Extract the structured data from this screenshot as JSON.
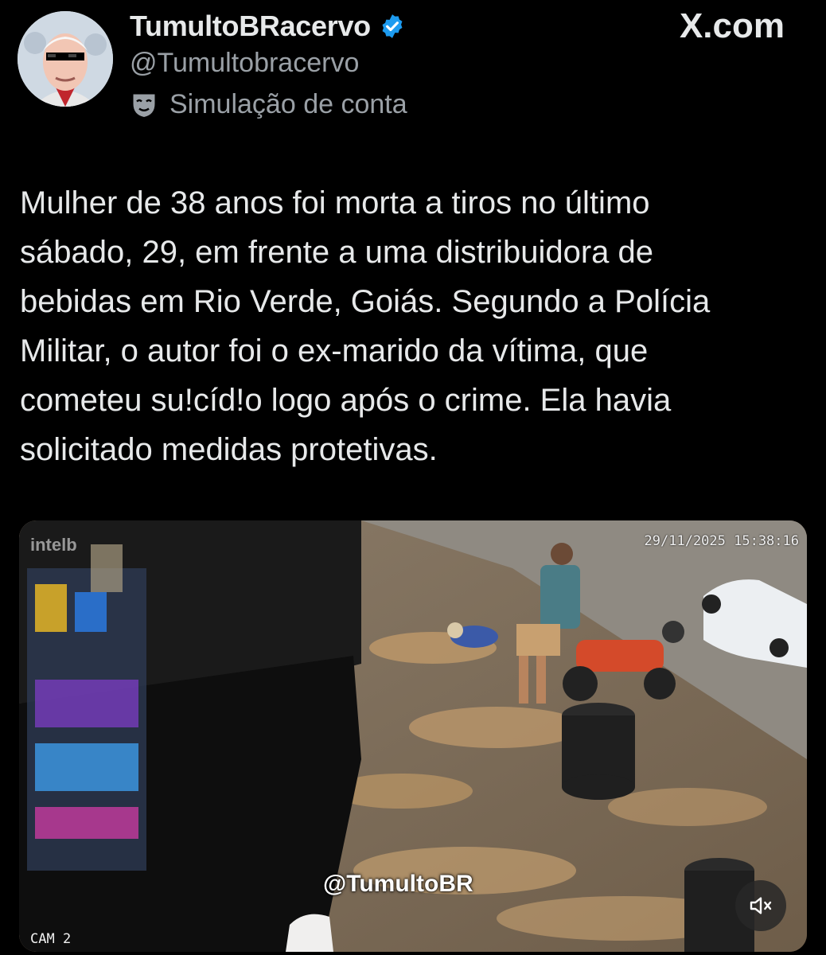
{
  "author": {
    "display_name": "TumultoBRacervo",
    "handle": "@Tumultobracervo",
    "label": "Simulação de conta",
    "avatar_icon": "profile-avatar",
    "verified_icon": "verified-badge-icon",
    "label_icon": "theater-mask-icon"
  },
  "source": {
    "site": "X.com"
  },
  "tweet": {
    "text": "Mulher de 38 anos foi morta a tiros no último\nsábado, 29, em frente a uma distribuidora de\nbebidas em Rio Verde, Goiás. Segundo a Polícia\nMilitar, o autor foi o ex-marido da vítima, que\ncometeu su!cíd!o logo após o crime. Ela havia\nsolicitado medidas protetivas."
  },
  "media": {
    "timestamp": "29/11/2025 15:38:16",
    "camera_label": "CAM 2",
    "brand": "intelb",
    "watermark": "@TumultoBR",
    "mute_icon": "speaker-muted-icon"
  },
  "colors": {
    "background": "#000000",
    "text": "#e7e9ea",
    "secondary_text": "#9aa0a6",
    "verified": "#1d9bf0"
  }
}
